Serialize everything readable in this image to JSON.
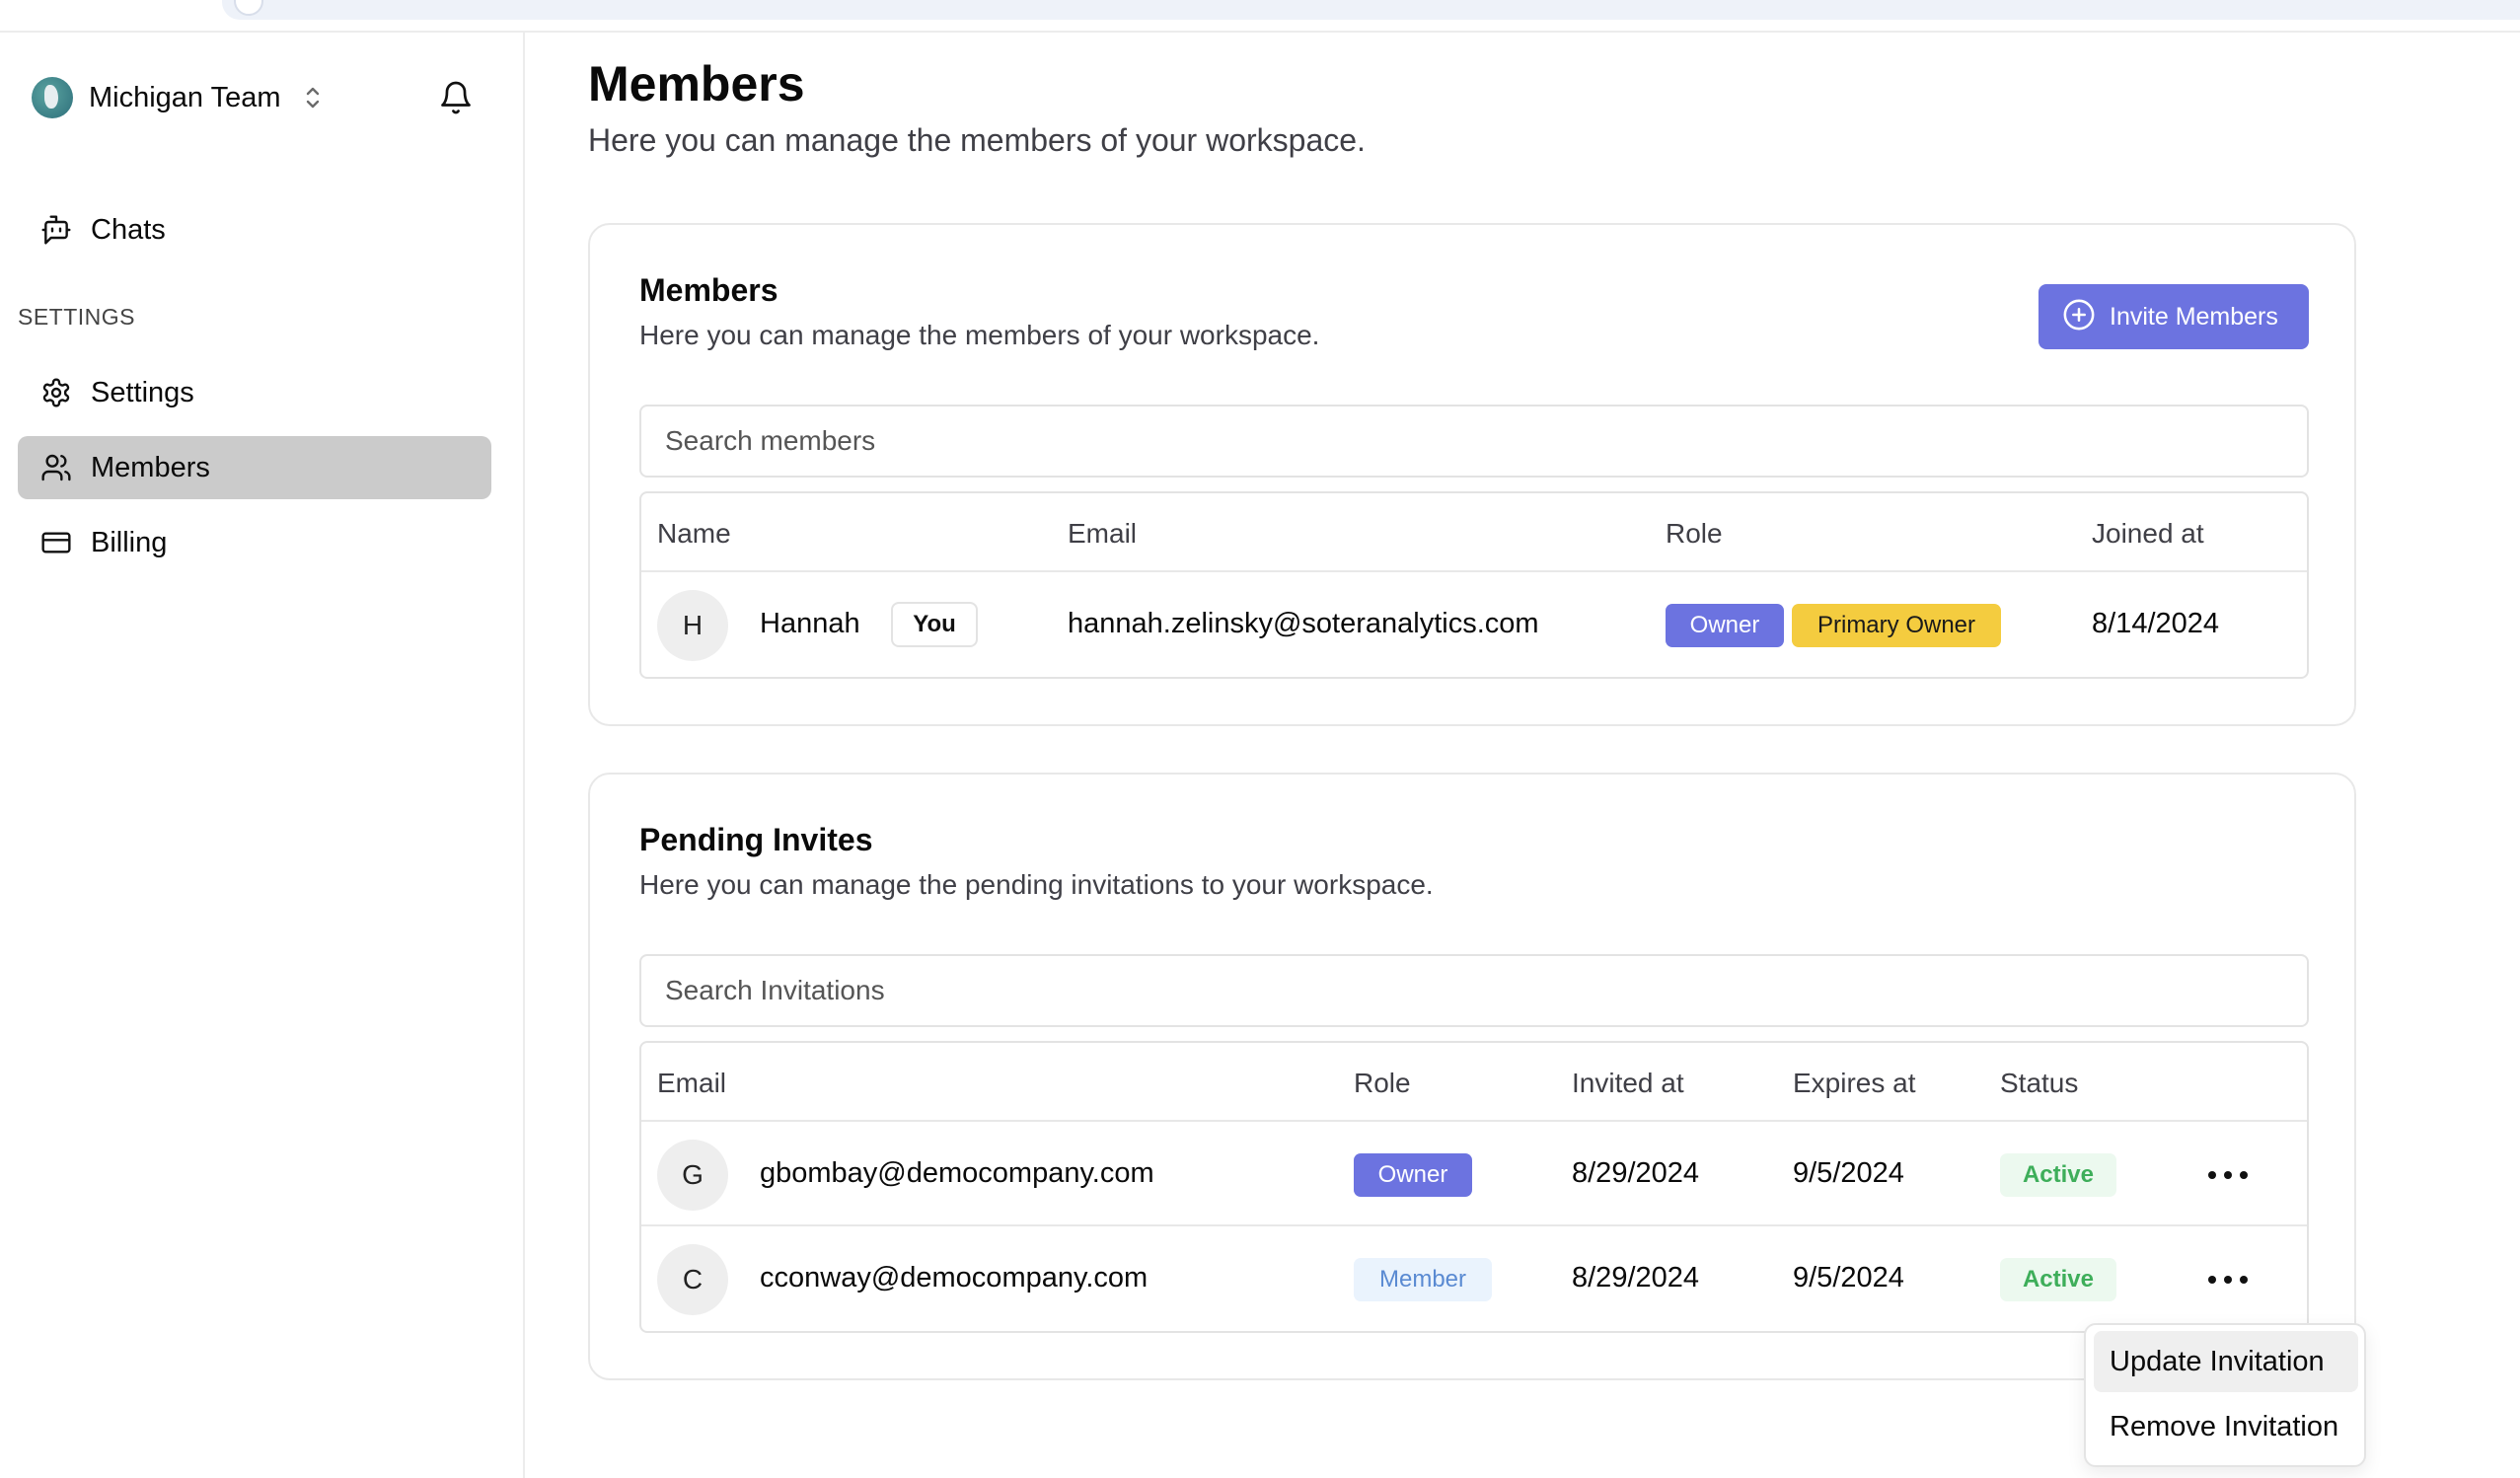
{
  "workspace": {
    "name": "Michigan Team"
  },
  "sidebar": {
    "items": [
      {
        "label": "Chats",
        "icon": "bot-icon"
      },
      {
        "label": "Settings",
        "icon": "gear-icon"
      },
      {
        "label": "Members",
        "icon": "users-icon",
        "active": true
      },
      {
        "label": "Billing",
        "icon": "credit-card-icon"
      }
    ],
    "section_label": "SETTINGS"
  },
  "page": {
    "title": "Members",
    "subtitle": "Here you can manage the members of your workspace."
  },
  "members_card": {
    "title": "Members",
    "subtitle": "Here you can manage the members of your workspace.",
    "invite_button": "Invite Members",
    "search_placeholder": "Search members",
    "columns": [
      "Name",
      "Email",
      "Role",
      "Joined at"
    ],
    "rows": [
      {
        "initial": "H",
        "name": "Hannah",
        "you_badge": "You",
        "email": "hannah.zelinsky@soteranalytics.com",
        "roles": [
          "Owner",
          "Primary Owner"
        ],
        "joined_at": "8/14/2024"
      }
    ]
  },
  "pending_card": {
    "title": "Pending Invites",
    "subtitle": "Here you can manage the pending invitations to your workspace.",
    "search_placeholder": "Search Invitations",
    "columns": [
      "Email",
      "Role",
      "Invited at",
      "Expires at",
      "Status"
    ],
    "rows": [
      {
        "initial": "G",
        "email": "gbombay@democompany.com",
        "role": "Owner",
        "invited_at": "8/29/2024",
        "expires_at": "9/5/2024",
        "status": "Active"
      },
      {
        "initial": "C",
        "email": "cconway@democompany.com",
        "role": "Member",
        "invited_at": "8/29/2024",
        "expires_at": "9/5/2024",
        "status": "Active"
      }
    ]
  },
  "menu": {
    "items": [
      "Update Invitation",
      "Remove Invitation"
    ]
  },
  "colors": {
    "accent": "#6c73e0",
    "primary_owner_badge": "#f4cc3f",
    "active_status": "#3eae5a",
    "sidebar_active": "#cbcbcb"
  }
}
